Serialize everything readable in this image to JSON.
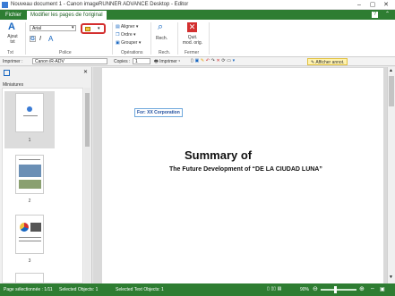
{
  "window": {
    "title": "Nouveau document 1 - Canon imageRUNNER ADVANCE Desktop - Editor"
  },
  "tabs": [
    {
      "label": "Fichier"
    },
    {
      "label": "Modifier les pages de l'original"
    }
  ],
  "ribbon": {
    "add_text_label": "Ajout\ntxt",
    "font_name": "Arial",
    "align_label": "Aligner",
    "order_label": "Ordre",
    "group_label": "Grouper",
    "search_label": "Rech.",
    "exit_label": "Quit.\nmod. orig.",
    "groups": {
      "text": "Txt",
      "font": "Police",
      "operations": "Opérations",
      "search": "Rech.",
      "close": "Fermer"
    }
  },
  "toolbar": {
    "printer_label": "Imprimer :",
    "printer_value": "Canon iR-ADV",
    "copies_label": "Copies :",
    "copies_value": "1",
    "print_label": "Imprimer",
    "annotations_label": "Afficher annot."
  },
  "left_panel": {
    "title": "Miniatures",
    "pages": [
      "1",
      "2",
      "3"
    ]
  },
  "document": {
    "textbox": "For: XX Corporation",
    "title": "Summary of",
    "subtitle": "The Future Development of “DE LA CIUDAD LUNA”"
  },
  "status": {
    "page": "Page sélectionnée : 1/11",
    "selected_objects": "Selected Objects: 1",
    "selected_text": "Selected Text Objects: 1",
    "zoom": "90%"
  },
  "colors": {
    "accent": "#2e7d32",
    "highlight": "#d32f2f"
  }
}
